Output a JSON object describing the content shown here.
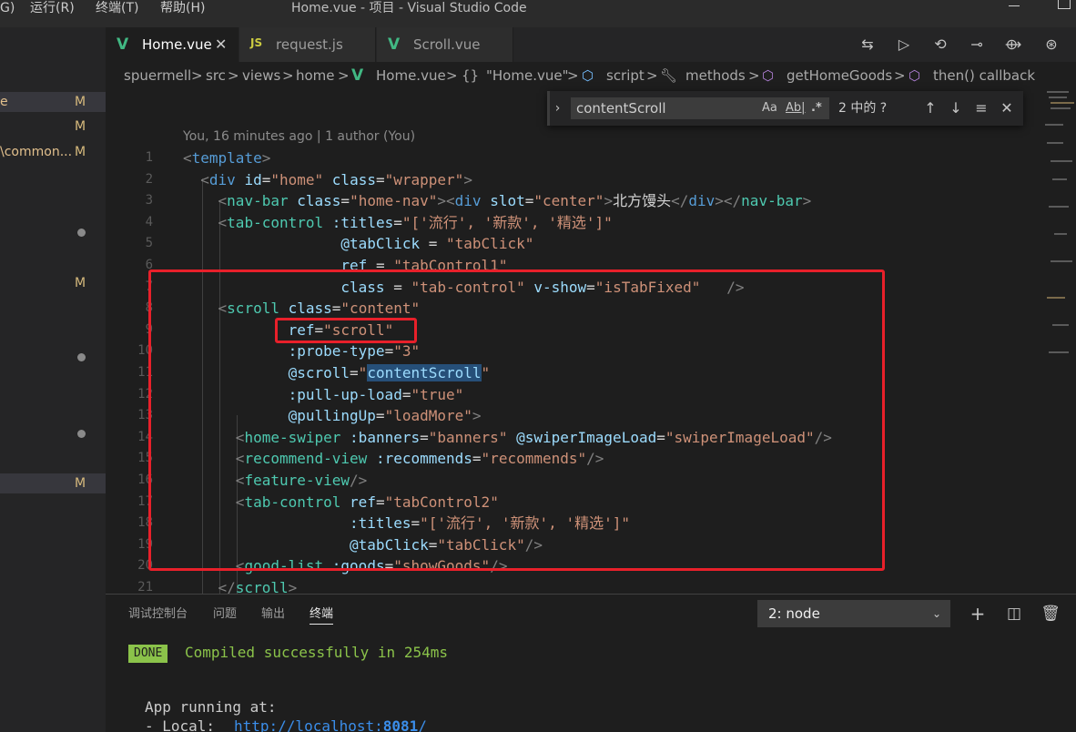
{
  "menubar": {
    "items": [
      "G)",
      "运行(R)",
      "终端(T)",
      "帮助(H)"
    ],
    "window_title": "Home.vue - 项目 - Visual Studio Code"
  },
  "sidebar": {
    "rows": [
      {
        "name": "e",
        "badge": "M",
        "selected": true
      },
      {
        "name": "",
        "badge": "M",
        "selected": false
      },
      {
        "name": "\\common...",
        "badge": "M",
        "selected": false
      },
      {
        "name": "",
        "badge": "M",
        "selected": false
      },
      {
        "name": "",
        "badge": "M",
        "selected": true
      }
    ]
  },
  "tabs": [
    {
      "label": "Home.vue",
      "icon": "vue-icon",
      "active": true,
      "close": "✕"
    },
    {
      "label": "request.js",
      "icon": "js-icon",
      "active": false,
      "icon_text": "JS"
    },
    {
      "label": "Scroll.vue",
      "icon": "vue-icon",
      "active": false
    }
  ],
  "breadcrumb": {
    "items": [
      "spuermell",
      "src",
      "views",
      "home",
      "Home.vue",
      "\"Home.vue\"",
      "script",
      "methods",
      "getHomeGoods",
      "then() callback"
    ]
  },
  "find": {
    "query": "contentScroll",
    "match_case": "Aa",
    "whole_word": "Ab|",
    "regex": ".*",
    "count": "2 中的 ?"
  },
  "codelens": "You, 16 minutes ago | 1 author (You)",
  "editor": {
    "line_numbers": [
      "1",
      "2",
      "3",
      "4",
      "5",
      "6",
      "7",
      "8",
      "9",
      "10",
      "11",
      "12",
      "13",
      "14",
      "15",
      "16",
      "17",
      "18",
      "19",
      "20",
      "21"
    ]
  },
  "panel": {
    "tabs": [
      "调试控制台",
      "问题",
      "输出",
      "终端"
    ],
    "active_tab": "终端",
    "terminal_select": "2: node",
    "done_label": "DONE",
    "compiled_msg": "Compiled successfully in 254ms",
    "app_running": "App running at:",
    "local_label": "- Local:   ",
    "local_url_host": "http://localhost:",
    "local_url_port": "8081",
    "local_url_tail": "/"
  },
  "colors": {
    "accent_red": "#e8202a",
    "vue_green": "#41b883",
    "modified": "#d7ba7d",
    "done_green": "#8bc34a"
  }
}
